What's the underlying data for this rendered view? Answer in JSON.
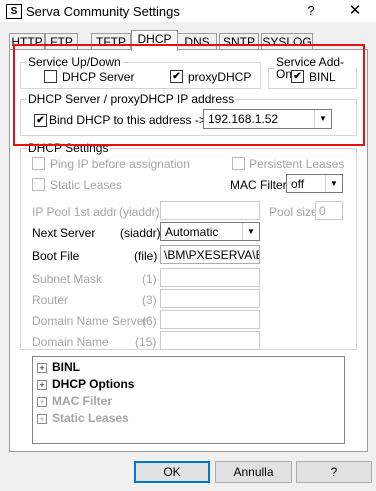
{
  "window": {
    "title": "Serva Community Settings",
    "app_icon": "S",
    "help": "?",
    "close": "✕"
  },
  "tabs": [
    "HTTP",
    "FTP",
    "TFTP",
    "DHCP",
    "DNS",
    "SNTP",
    "SYSLOG"
  ],
  "active_tab": "DHCP",
  "service_updown": {
    "legend": "Service Up/Down",
    "dhcp_server": "DHCP Server",
    "dhcp_server_checked": false,
    "proxydhcp": "proxyDHCP",
    "proxydhcp_checked": true
  },
  "service_addon": {
    "legend": "Service Add-On",
    "binl": "BINL",
    "binl_checked": true
  },
  "bind": {
    "legend": "DHCP Server / proxyDHCP IP address",
    "label": "Bind DHCP to this address  ->",
    "checked": true,
    "address": "192.168.1.52"
  },
  "dhcp_settings": {
    "legend": "DHCP Settings",
    "ping_ip": "Ping IP before assignation",
    "persistent_leases": "Persistent Leases",
    "static_leases": "Static Leases",
    "mac_filter_label": "MAC Filter",
    "mac_filter_value": "off",
    "ip_pool_label": "IP Pool 1st addr",
    "ip_pool_code": "(yiaddr)",
    "pool_size_label": "Pool size",
    "pool_size_value": "0",
    "next_server_label": "Next Server",
    "next_server_code": "(siaddr)",
    "next_server_value": "Automatic",
    "boot_file_label": "Boot File",
    "boot_file_code": "(file)",
    "boot_file_value": "\\BM\\PXESERVA\\BIO",
    "subnet_mask_label": "Subnet Mask",
    "subnet_mask_code": "(1)",
    "router_label": "Router",
    "router_code": "(3)",
    "domain_name_server_label": "Domain Name Server",
    "domain_name_server_code": "(6)",
    "domain_name_label": "Domain Name",
    "domain_name_code": "(15)"
  },
  "tree": [
    {
      "label": "BINL",
      "expander": "+",
      "enabled": true
    },
    {
      "label": "DHCP Options",
      "expander": "+",
      "enabled": true
    },
    {
      "label": "MAC Filter",
      "expander": "+",
      "enabled": false
    },
    {
      "label": "Static Leases",
      "expander": "+",
      "enabled": false
    }
  ],
  "buttons": {
    "ok": "OK",
    "cancel": "Annulla",
    "help": "?"
  },
  "colors": {
    "highlight_box": "#e51010",
    "disabled_text": "#a5a5a5",
    "default_button_border": "#0078d7"
  }
}
